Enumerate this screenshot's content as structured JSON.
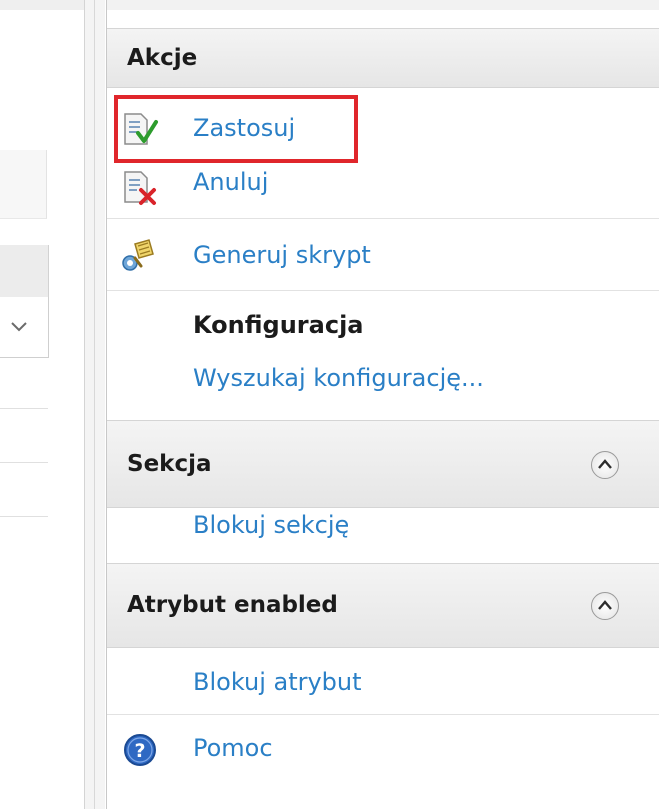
{
  "actions_pane": {
    "title": "Akcje",
    "items": {
      "apply": "Zastosuj",
      "cancel": "Anuluj",
      "generate_script": "Generuj skrypt"
    },
    "configuration": {
      "heading": "Konfiguracja",
      "search": "Wyszukaj konfigurację..."
    },
    "section": {
      "title": "Sekcja",
      "lock_section": "Blokuj sekcję"
    },
    "attribute": {
      "title": "Atrybut enabled",
      "lock_attribute": "Blokuj atrybut"
    },
    "help": "Pomoc"
  },
  "colors": {
    "link": "#2a7fc6",
    "highlight": "#e0262b"
  },
  "icons": {
    "apply": "document-checkmark-icon",
    "cancel": "document-x-icon",
    "generate_script": "script-scroll-icon",
    "help": "help-icon",
    "collapse": "chevron-up-icon",
    "combo": "chevron-down-icon"
  }
}
